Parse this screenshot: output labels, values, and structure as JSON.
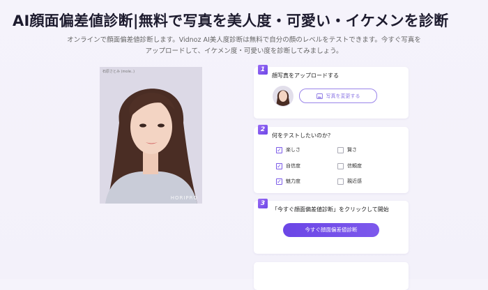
{
  "header": {
    "title": "AI顔面偏差値診断|無料で写真を美人度・可愛い・イケメンを診断",
    "description_line1": "オンラインで顔面偏差値診断します。Vidnoz AI美人度診断は無料で自分の顔のレベルをテストできます。今すぐ写真を",
    "description_line2": "アップロードして、イケメン度・可愛い度を診断してみましょう。"
  },
  "photo": {
    "caption": "石原さとみ (mole..)",
    "watermark": "HORIPRO"
  },
  "step1": {
    "number": "1",
    "heading": "顔写真をアップロードする",
    "change_button": "写真を変更する"
  },
  "step2": {
    "number": "2",
    "heading": "何をテストしたいのか？",
    "options": [
      {
        "label": "楽しさ",
        "checked": true
      },
      {
        "label": "賢さ",
        "checked": false
      },
      {
        "label": "自信度",
        "checked": true
      },
      {
        "label": "信頼度",
        "checked": false
      },
      {
        "label": "魅力度",
        "checked": true
      },
      {
        "label": "親近感",
        "checked": false
      }
    ]
  },
  "step3": {
    "number": "3",
    "heading": "「今すぐ顔面偏差値診断」をクリックして開始",
    "start_button": "今すぐ顔面偏差値診断"
  },
  "colors": {
    "accent": "#6d47e6",
    "background": "#f4f2fa"
  }
}
